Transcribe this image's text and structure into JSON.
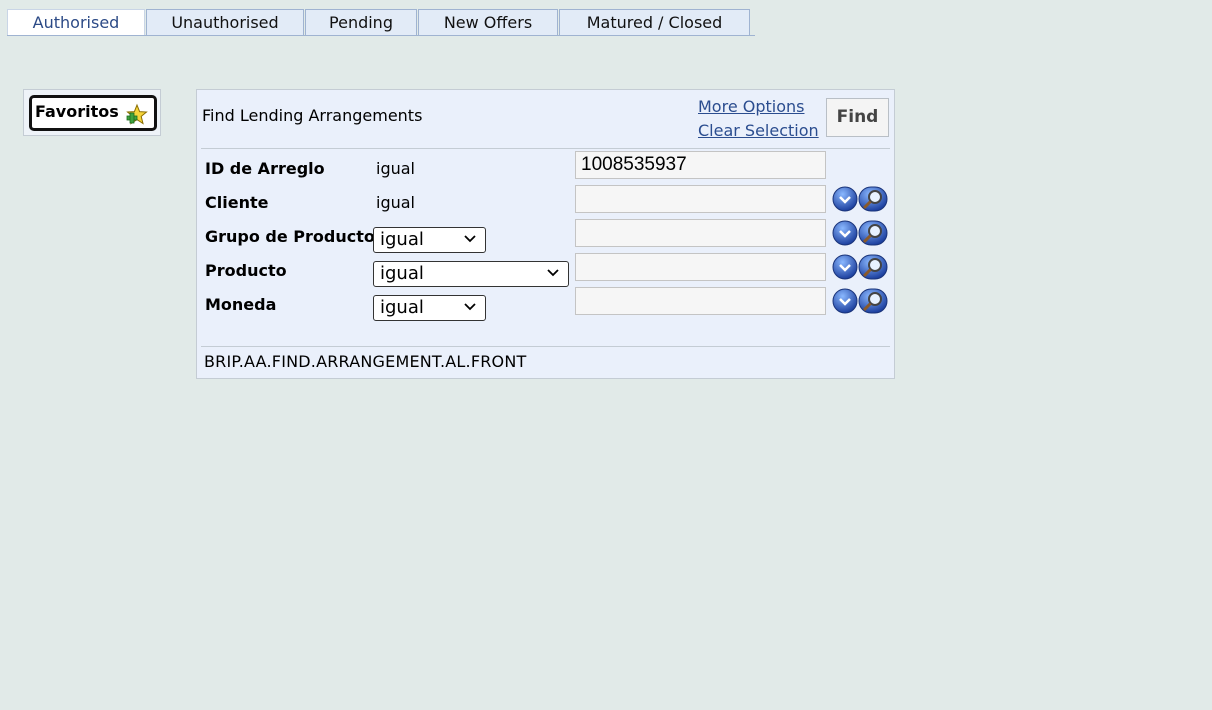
{
  "tabs": [
    {
      "label": "Authorised",
      "active": true
    },
    {
      "label": "Unauthorised",
      "active": false
    },
    {
      "label": "Pending",
      "active": false
    },
    {
      "label": "New Offers",
      "active": false
    },
    {
      "label": "Matured / Closed",
      "active": false
    }
  ],
  "favorites": {
    "label": "Favoritos",
    "icon": "star-add-icon"
  },
  "panel": {
    "title": "Find Lending Arrangements",
    "more_options": "More Options",
    "clear_selection": "Clear Selection",
    "find_label": "Find",
    "footer": "BRIP.AA.FIND.ARRANGEMENT.AL.FRONT"
  },
  "fields": [
    {
      "label": "ID de Arreglo",
      "operator": "igual",
      "operator_type": "text",
      "value": "1008535937"
    },
    {
      "label": "Cliente",
      "operator": "igual",
      "operator_type": "text",
      "value": ""
    },
    {
      "label": "Grupo de Producto",
      "operator": "igual",
      "operator_type": "select",
      "value": ""
    },
    {
      "label": "Producto",
      "operator": "igual",
      "operator_type": "select",
      "value": ""
    },
    {
      "label": "Moneda",
      "operator": "igual",
      "operator_type": "select",
      "value": ""
    }
  ],
  "icons": {
    "dropdown": "dropdown-circle-icon",
    "lookup": "magnifier-icon"
  },
  "colors": {
    "background": "#e1eae8",
    "panel": "#eaf0fb",
    "link": "#2b4d8f",
    "active_tab_text": "#2c4a86"
  }
}
